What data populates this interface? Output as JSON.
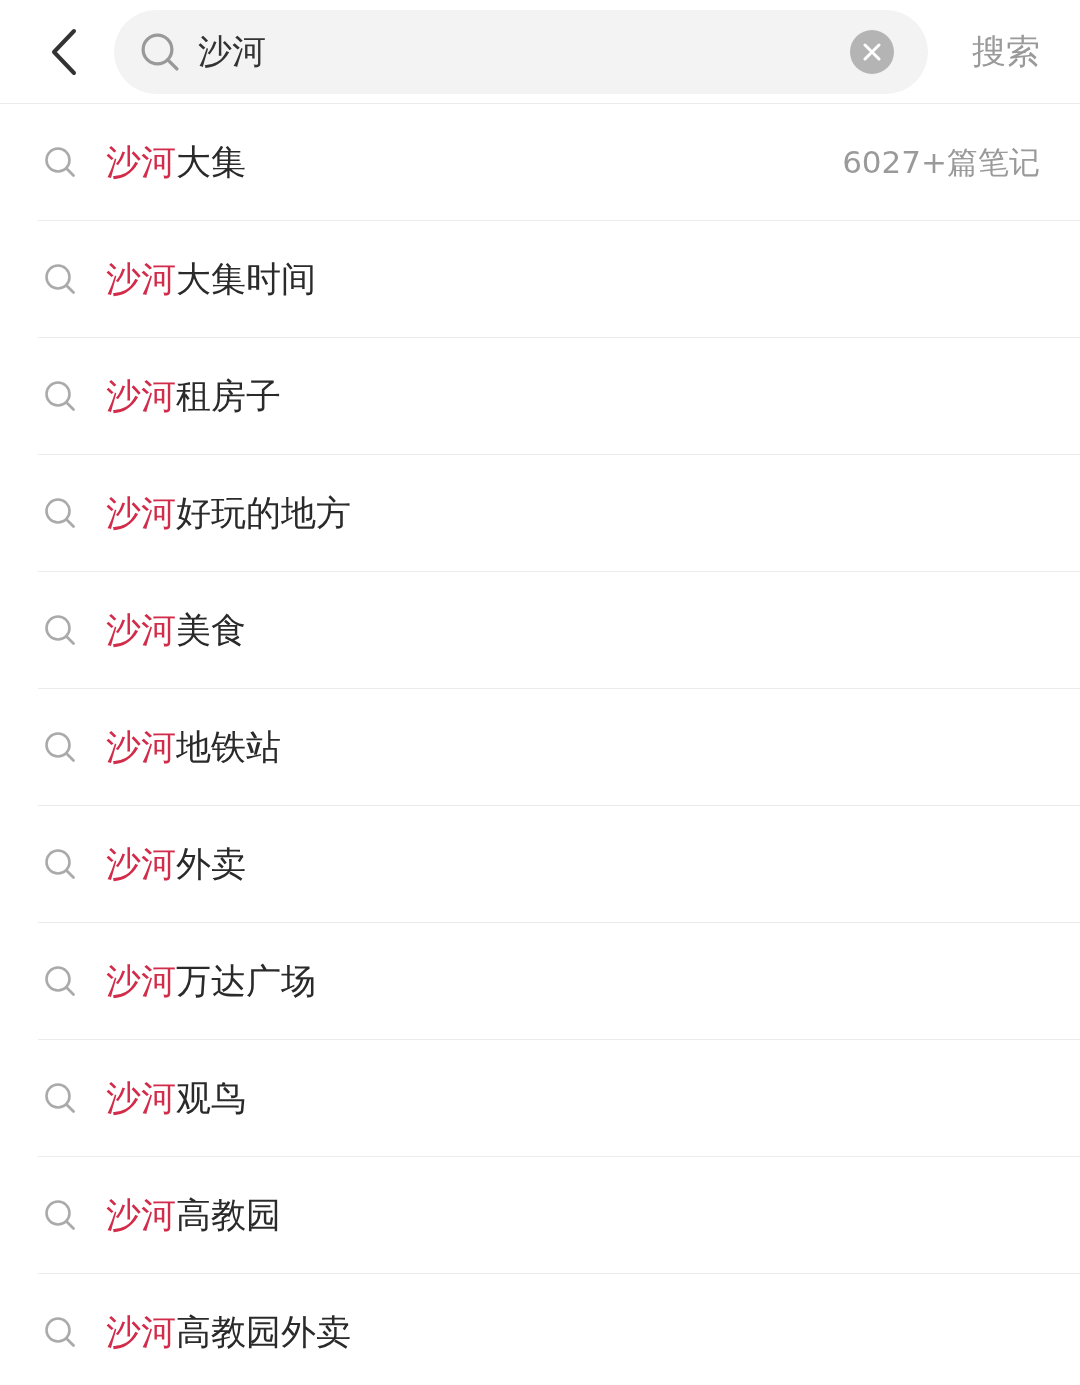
{
  "header": {
    "query": "沙河",
    "action": "搜索"
  },
  "suggestions": [
    {
      "match": "沙河",
      "rest": "大集",
      "count": "6027+篇笔记"
    },
    {
      "match": "沙河",
      "rest": "大集时间"
    },
    {
      "match": "沙河",
      "rest": "租房子"
    },
    {
      "match": "沙河",
      "rest": "好玩的地方"
    },
    {
      "match": "沙河",
      "rest": "美食"
    },
    {
      "match": "沙河",
      "rest": "地铁站"
    },
    {
      "match": "沙河",
      "rest": "外卖"
    },
    {
      "match": "沙河",
      "rest": "万达广场"
    },
    {
      "match": "沙河",
      "rest": "观鸟"
    },
    {
      "match": "沙河",
      "rest": "高教园"
    },
    {
      "match": "沙河",
      "rest": "高教园外卖"
    }
  ]
}
